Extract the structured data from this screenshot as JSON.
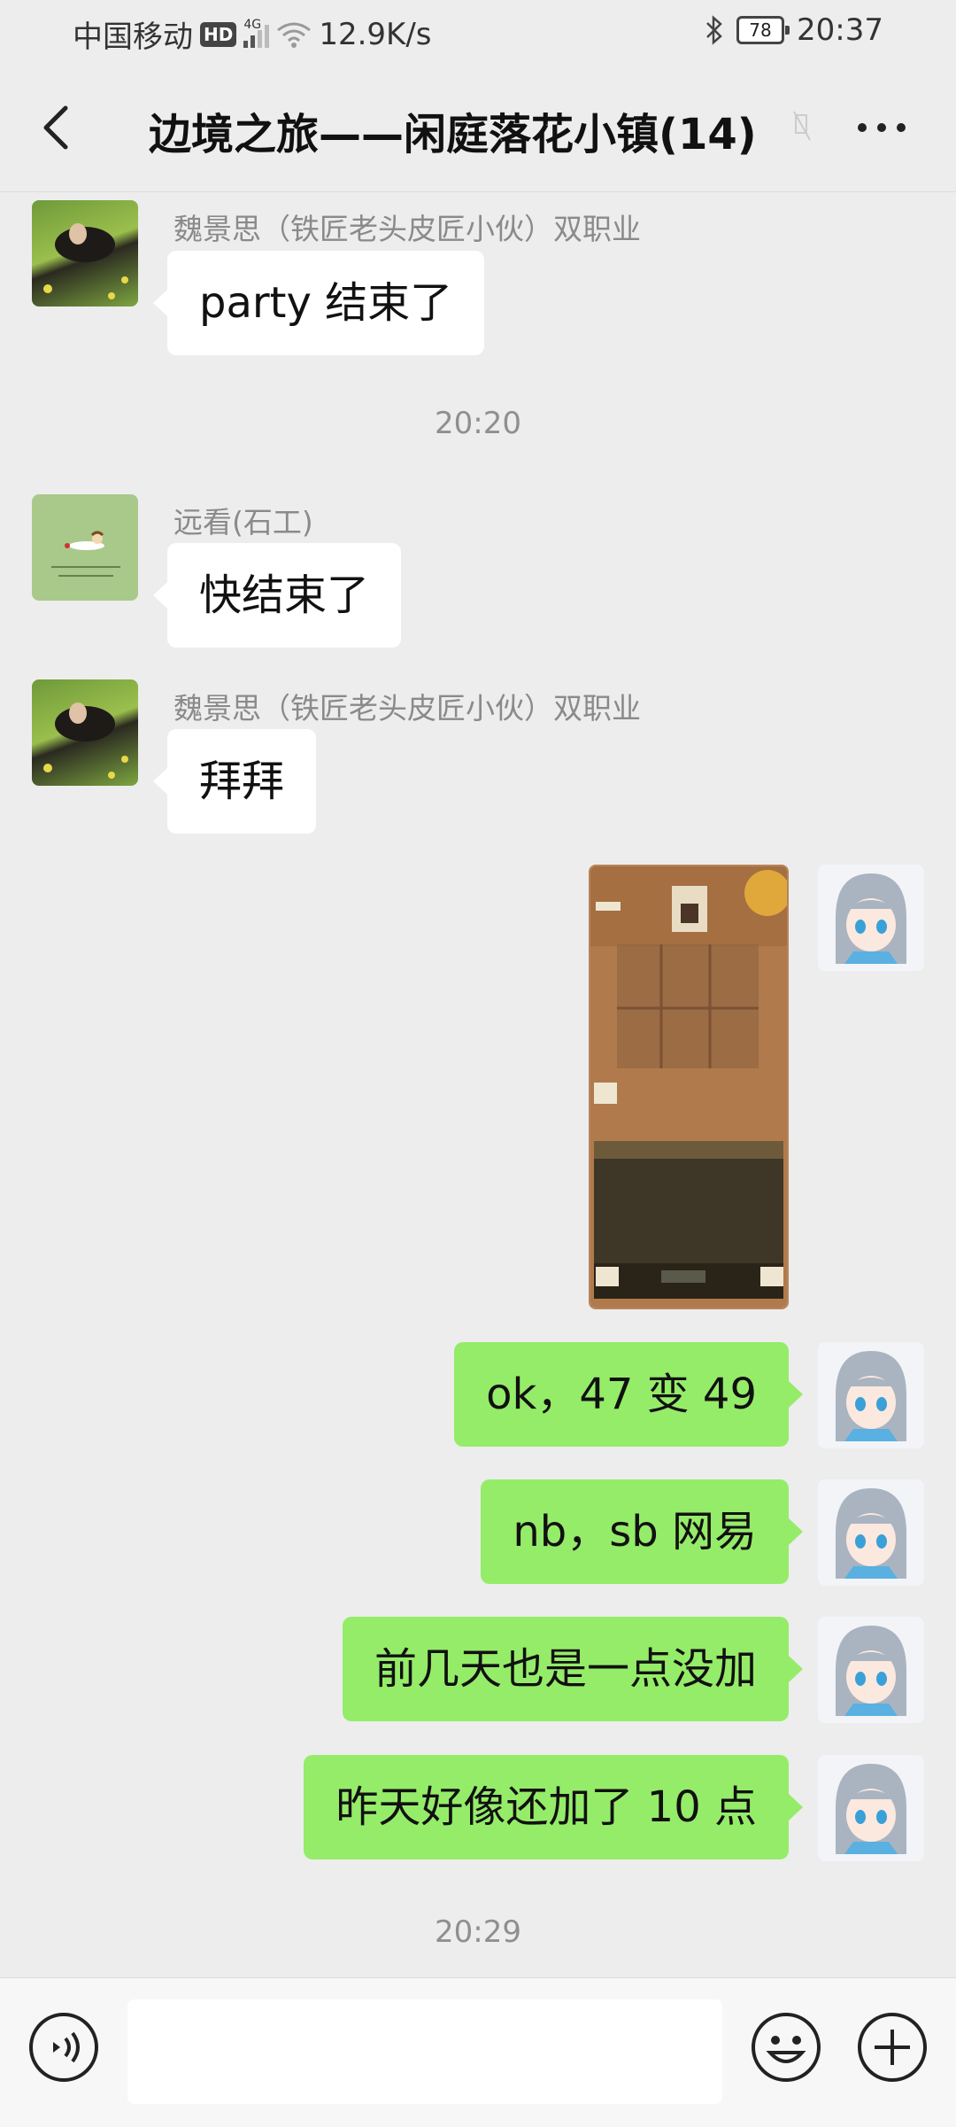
{
  "status_bar": {
    "carrier": "中国移动",
    "hd": "HD",
    "network": "4G",
    "speed": "12.9K/s",
    "battery": "78",
    "time": "20:37"
  },
  "header": {
    "title": "边境之旅——闲庭落花小镇(14)"
  },
  "messages": [
    {
      "sender": "魏景思（铁匠老头皮匠小伙）双职业",
      "text": "party 结束了"
    },
    {
      "sender": "远看(石工)",
      "text": "快结束了"
    },
    {
      "sender": "魏景思（铁匠老头皮匠小伙）双职业",
      "text": "拜拜"
    }
  ],
  "timestamps": [
    "20:20",
    "20:29"
  ],
  "outgoing": [
    {
      "text": "ok，47 变 49"
    },
    {
      "text": "nb，sb 网易"
    },
    {
      "text": "前几天也是一点没加"
    },
    {
      "text": "昨天好像还加了 10 点"
    }
  ],
  "colors": {
    "background": "#ededed",
    "outgoing_bubble": "#95ec69",
    "incoming_bubble": "#ffffff"
  }
}
